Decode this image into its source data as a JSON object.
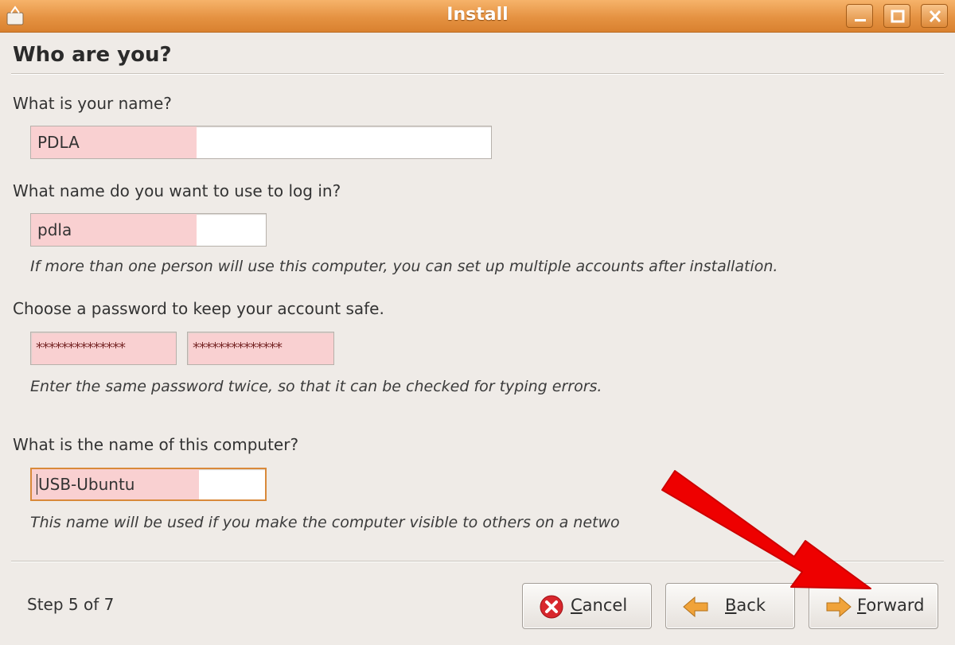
{
  "window": {
    "title": "Install"
  },
  "page": {
    "heading": "Who are you?"
  },
  "name_section": {
    "label": "What is your name?",
    "value": "PDLA"
  },
  "login_section": {
    "label": "What name do you want to use to log in?",
    "value": "pdla",
    "hint": "If more than one person will use this computer, you can set up multiple accounts after installation."
  },
  "password_section": {
    "label": "Choose a password to keep your account safe.",
    "password_mask": "**************",
    "confirm_mask": "**************",
    "hint": "Enter the same password twice, so that it can be checked for typing errors."
  },
  "computer_section": {
    "label": "What is the name of this computer?",
    "value": "USB-Ubuntu",
    "hint": "This name will be used if you make the computer visible to others on a netwo"
  },
  "footer": {
    "step": "Step 5 of 7",
    "cancel_mnemonic": "C",
    "cancel_rest": "ancel",
    "back_mnemonic": "B",
    "back_rest": "ack",
    "forward_mnemonic": "F",
    "forward_rest": "orward"
  },
  "icons": {
    "cancel": "cancel-icon",
    "back": "back-arrow-icon",
    "forward": "forward-arrow-icon",
    "annotation": "red-arrow-pointer"
  },
  "colors": {
    "titlebar": "#e59242",
    "invalid_field": "#f9d0d1",
    "focus_border": "#d9893a",
    "annotation_arrow": "#ee0000"
  }
}
